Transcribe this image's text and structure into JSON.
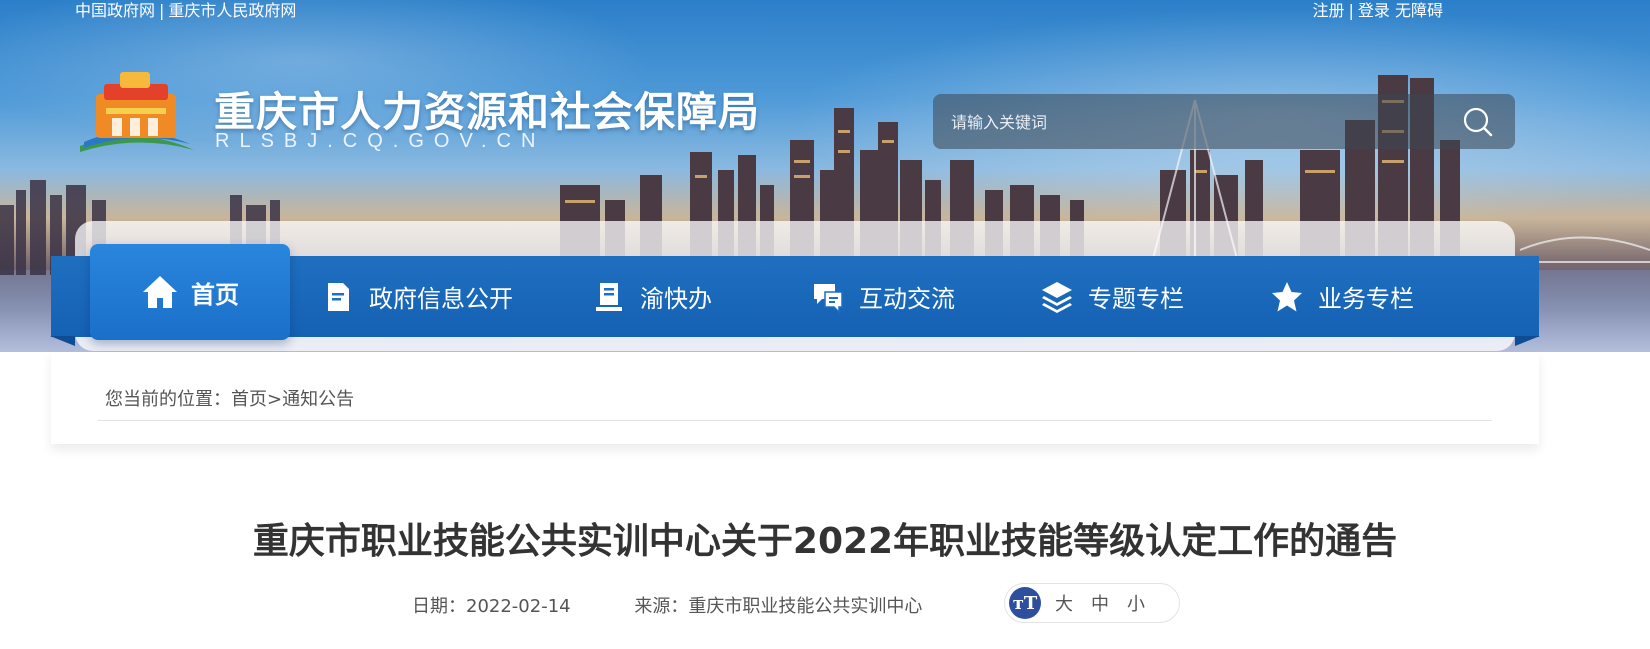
{
  "top_links": {
    "left": [
      "中国政府网",
      "重庆市人民政府网"
    ],
    "right": [
      "注册",
      "登录",
      "无障碍"
    ],
    "separator": "|"
  },
  "site": {
    "title": "重庆市人力资源和社会保障局",
    "subtitle": "RLSBJ.CQ.GOV.CN"
  },
  "search": {
    "placeholder": "请输入关键词",
    "icon": "search-icon"
  },
  "nav": {
    "items": [
      {
        "label": "首页",
        "icon": "home-icon",
        "active": true
      },
      {
        "label": "政府信息公开",
        "icon": "document-icon"
      },
      {
        "label": "渝快办",
        "icon": "book-icon"
      },
      {
        "label": "互动交流",
        "icon": "chat-icon"
      },
      {
        "label": "专题专栏",
        "icon": "layers-icon"
      },
      {
        "label": "业务专栏",
        "icon": "star-icon"
      }
    ]
  },
  "breadcrumb": {
    "prefix": "您当前的位置：",
    "home": "首页",
    "separator": ">",
    "current": "通知公告"
  },
  "article": {
    "title": "重庆市职业技能公共实训中心关于2022年职业技能等级认定工作的通告",
    "date_label": "日期：",
    "date": "2022-02-14",
    "source_label": "来源：",
    "source": "重庆市职业技能公共实训中心"
  },
  "font_size": {
    "icon_text": "тT",
    "options": [
      "大",
      "中",
      "小"
    ]
  },
  "colors": {
    "nav_blue": "#1a6fc9",
    "text_dark": "#333333",
    "font_badge": "#2d4f9e"
  }
}
